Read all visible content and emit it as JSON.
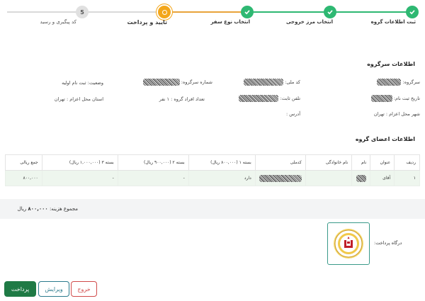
{
  "stepper": {
    "steps": [
      {
        "label": "ثبت اطلاعات گروه",
        "status": "done"
      },
      {
        "label": "انتخاب مرز خروجی",
        "status": "done"
      },
      {
        "label": "انتخاب نوع سفر",
        "status": "done"
      },
      {
        "label": "تایید و پرداخت",
        "status": "current"
      },
      {
        "label": "کد پیگیری و رسید",
        "status": "pending",
        "number": "5"
      }
    ]
  },
  "leader": {
    "title": "اطلاعات سرگروه",
    "name_label": "سرگروه:",
    "national_code_label": "کد ملی:",
    "group_number_label": "شماره سرگروه:",
    "status_label": "وضعیت:",
    "status_value": "ثبت نام اولیه",
    "register_date_label": "تاریخ ثبت نام:",
    "phone_label": "تلفن ثابت:",
    "members_count_label": "تعداد افراد گروه :",
    "members_count_value": "۱ نفر",
    "dispatch_province_label": "استان محل اعزام :",
    "dispatch_province_value": "تهران",
    "dispatch_city_label": "شهر محل اعزام :",
    "dispatch_city_value": "تهران",
    "address_label": "آدرس :"
  },
  "members": {
    "title": "اطلاعات اعضای گروه",
    "columns": [
      "ردیف",
      "عنوان",
      "نام",
      "نام خانوادگی",
      "کدملی",
      "بسته ۱ (۸۰۰,۰۰۰ ریال)",
      "بسته ۲ (۹۰۰,۰۰۰ ریال)",
      "بسته ۳ (۱,۰۰۰,۰۰۰ ریال)",
      "جمع ریالی"
    ],
    "rows": [
      {
        "row": "۱",
        "title": "آقای",
        "package1": "دارد",
        "package2": "-",
        "package3": "-",
        "total": "۸۰۰,۰۰۰"
      }
    ]
  },
  "total": {
    "label": "مجموع هزینه:",
    "value": "۸۰۰,۰۰۰",
    "unit": "ریال"
  },
  "gateway": {
    "label": "درگاه پرداخت:",
    "bank_icon": "bank-melli-logo"
  },
  "buttons": {
    "pay": "پرداخت",
    "edit": "ویرایش",
    "exit": "خروج"
  },
  "colors": {
    "done": "#2eb872",
    "current": "#f3a61a",
    "pay_button": "#1f7a45",
    "edit_button": "#2b7a8c",
    "exit_button": "#d04a4a"
  }
}
